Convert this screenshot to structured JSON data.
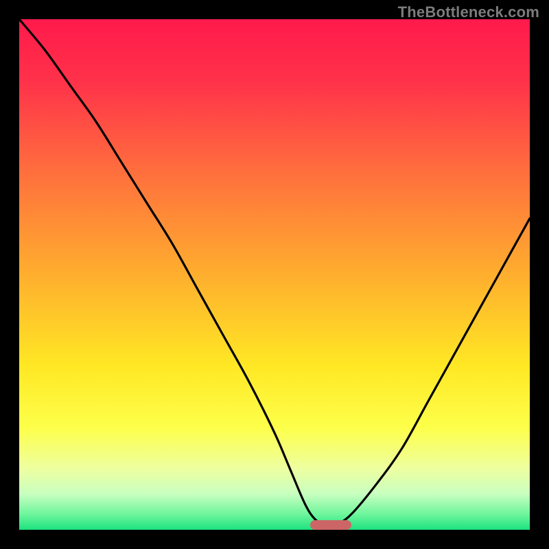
{
  "watermark": "TheBottleneck.com",
  "chart_data": {
    "type": "line",
    "title": "",
    "xlabel": "",
    "ylabel": "",
    "xlim": [
      0,
      100
    ],
    "ylim": [
      0,
      100
    ],
    "grid": false,
    "legend": false,
    "series": [
      {
        "name": "bottleneck-curve",
        "x": [
          0,
          5,
          10,
          15,
          20,
          25,
          30,
          35,
          40,
          45,
          50,
          53,
          56,
          58,
          60,
          62,
          65,
          70,
          75,
          80,
          85,
          90,
          95,
          100
        ],
        "y": [
          100,
          94,
          87,
          80,
          72,
          64,
          56,
          47,
          38,
          29,
          19,
          12,
          5,
          2,
          1,
          1,
          3,
          9,
          16,
          25,
          34,
          43,
          52,
          61
        ]
      }
    ],
    "marker": {
      "name": "optimum-region",
      "x_start": 57,
      "x_end": 65,
      "y": 1
    },
    "gradient_stops": [
      {
        "pct": 0,
        "color": "#ff1a4b"
      },
      {
        "pct": 12,
        "color": "#ff314a"
      },
      {
        "pct": 30,
        "color": "#ff6f3d"
      },
      {
        "pct": 50,
        "color": "#ffae2e"
      },
      {
        "pct": 68,
        "color": "#ffe824"
      },
      {
        "pct": 80,
        "color": "#fdff4a"
      },
      {
        "pct": 88,
        "color": "#eeffa0"
      },
      {
        "pct": 93,
        "color": "#c8ffc0"
      },
      {
        "pct": 97,
        "color": "#6cf59b"
      },
      {
        "pct": 100,
        "color": "#1de27f"
      }
    ]
  }
}
